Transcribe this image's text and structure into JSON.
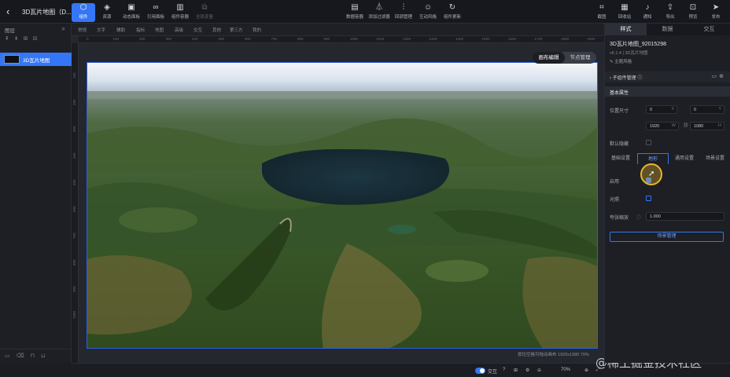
{
  "app": {
    "title": "3D瓦片地图（D..."
  },
  "toolbar": {
    "left_tools": [
      {
        "label": "组件",
        "icon": "cube-icon",
        "active": true
      },
      {
        "label": "资源",
        "icon": "layers-icon"
      },
      {
        "label": "动态面板",
        "icon": "panel-icon"
      },
      {
        "label": "引用面板",
        "icon": "link-icon"
      },
      {
        "label": "组件容器",
        "icon": "container-icon"
      },
      {
        "label": "全局变量",
        "icon": "global-icon",
        "dim": true
      }
    ],
    "center_tools": [
      {
        "label": "数据容器",
        "icon": "data-icon"
      },
      {
        "label": "添加过滤器",
        "icon": "filter-icon"
      },
      {
        "label": "回调管理",
        "icon": "sliders-icon"
      },
      {
        "label": "互动风格",
        "icon": "user-icon"
      },
      {
        "label": "组件更新",
        "icon": "refresh-icon"
      }
    ],
    "right_tools": [
      {
        "label": "截图",
        "icon": "screenshot-icon"
      },
      {
        "label": "回收站",
        "icon": "trash-icon"
      },
      {
        "label": "通知",
        "icon": "bell-icon"
      },
      {
        "label": "导出",
        "icon": "export-icon"
      },
      {
        "label": "预览",
        "icon": "preview-icon"
      },
      {
        "label": "发布",
        "icon": "send-icon"
      }
    ]
  },
  "layers": {
    "header": "图层",
    "item_name": "3D瓦片地图"
  },
  "component_bar": [
    "常规",
    "文字",
    "辅助",
    "指标",
    "地图",
    "高级",
    "交互",
    "其他",
    "第三方",
    "我的"
  ],
  "ruler": {
    "h_ticks": [
      "0",
      "100",
      "200",
      "300",
      "400",
      "500",
      "600",
      "700",
      "800",
      "900",
      "1000",
      "1100",
      "1200",
      "1300",
      "1400",
      "1500",
      "1600",
      "1700",
      "1800",
      "1900"
    ],
    "v_ticks": [
      "100",
      "200",
      "300",
      "400",
      "500",
      "600",
      "700",
      "800",
      "900",
      "1000"
    ]
  },
  "canvas": {
    "mode_toggle": [
      "画布编辑",
      "节点管理"
    ],
    "mode_active": 0,
    "info": "按住空格可拖动画布  1920x1080 70%"
  },
  "status": {
    "toggle_label": "交互",
    "zoom": "70%"
  },
  "watermark": "@稀土掘金技术社区",
  "right_panel": {
    "tabs": [
      "样式",
      "数据",
      "交互"
    ],
    "active_tab": 0,
    "component_name": "3D瓦片地图_92015298",
    "version": "v6.1.4 | 3D瓦片地图",
    "theme": "主题风格",
    "sub_manager": "子组件管理",
    "basic_section": "基本属性",
    "position_label": "位置尺寸",
    "x": "0",
    "y": "0",
    "width": "1920",
    "height": "1080",
    "hide_label": "默认隐藏",
    "subtabs": [
      "基础设置",
      "地形",
      "通用设置",
      "场景设置"
    ],
    "subtab_active": 1,
    "enable_label": "启用",
    "lighting_label": "光照",
    "exaggeration_label": "夸张缩放",
    "exaggeration_value": "1.000",
    "scene_button": "场景管理"
  },
  "colors": {
    "accent": "#3576f6",
    "background": "#1b1d23",
    "cursor_highlight": "#e8b62a"
  }
}
